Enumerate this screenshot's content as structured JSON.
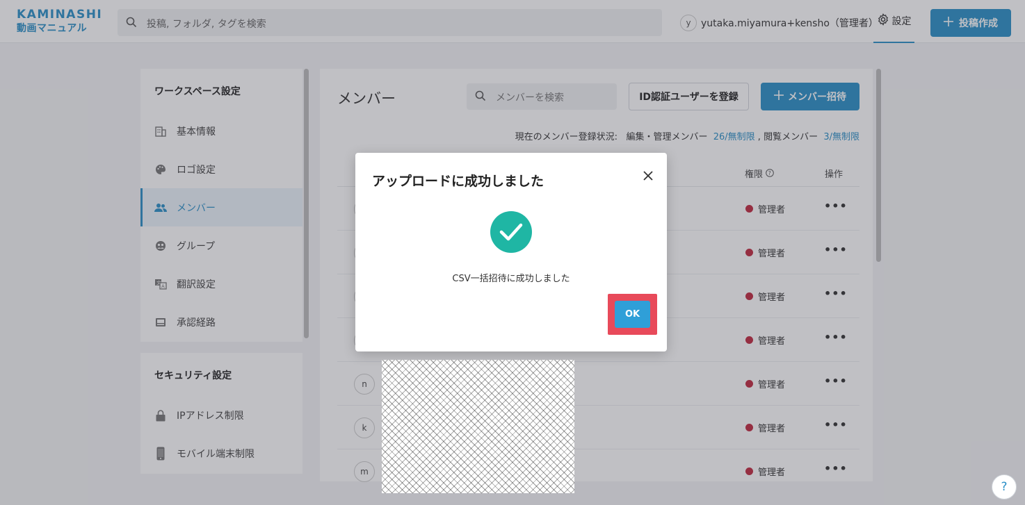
{
  "header": {
    "logo_main": "KAMINASHI",
    "logo_sub": "動画マニュアル",
    "search_placeholder": "投稿, フォルダ, タグを検索",
    "user_initial": "y",
    "user_name": "yutaka.miyamura+kensho（管理者）",
    "settings_label": "設定",
    "create_label": "投稿作成"
  },
  "sidebar": {
    "workspace_title": "ワークスペース設定",
    "items": [
      {
        "label": "基本情報",
        "icon": "building-icon"
      },
      {
        "label": "ロゴ設定",
        "icon": "palette-icon"
      },
      {
        "label": "メンバー",
        "icon": "users-icon"
      },
      {
        "label": "グループ",
        "icon": "group-icon"
      },
      {
        "label": "翻訳設定",
        "icon": "translate-icon"
      },
      {
        "label": "承認経路",
        "icon": "inbox-icon"
      }
    ],
    "security_title": "セキュリティ設定",
    "security_items": [
      {
        "label": "IPアドレス制限",
        "icon": "lock-icon"
      },
      {
        "label": "モバイル端末制限",
        "icon": "phone-icon"
      }
    ]
  },
  "main": {
    "title": "メンバー",
    "search_placeholder": "メンバーを検索",
    "id_register_label": "ID認証ユーザーを登録",
    "invite_label": "メンバー招待",
    "status_prefix": "現在のメンバー登録状況:",
    "edit_label": "編集・管理メンバー",
    "edit_count": "26/無制限",
    "view_label": "閲覧メンバー",
    "view_count": "3/無制限",
    "col_role": "権限",
    "col_ops": "操作",
    "rows": [
      {
        "initial": "",
        "role": "管理者"
      },
      {
        "initial": "",
        "role": "管理者"
      },
      {
        "initial": "",
        "role": "管理者"
      },
      {
        "initial": "",
        "role": "管理者"
      },
      {
        "initial": "n",
        "role": "管理者"
      },
      {
        "initial": "k",
        "role": "管理者"
      },
      {
        "initial": "m",
        "role": "管理者"
      }
    ],
    "ops_glyph": "•••"
  },
  "dialog": {
    "title": "アップロードに成功しました",
    "message": "CSV一括招待に成功しました",
    "ok_label": "OK"
  },
  "help_label": "?",
  "colors": {
    "accent": "#2a8fc7",
    "success": "#1fb6a4",
    "admin_dot": "#c0283f",
    "highlight": "#e84a5a"
  }
}
